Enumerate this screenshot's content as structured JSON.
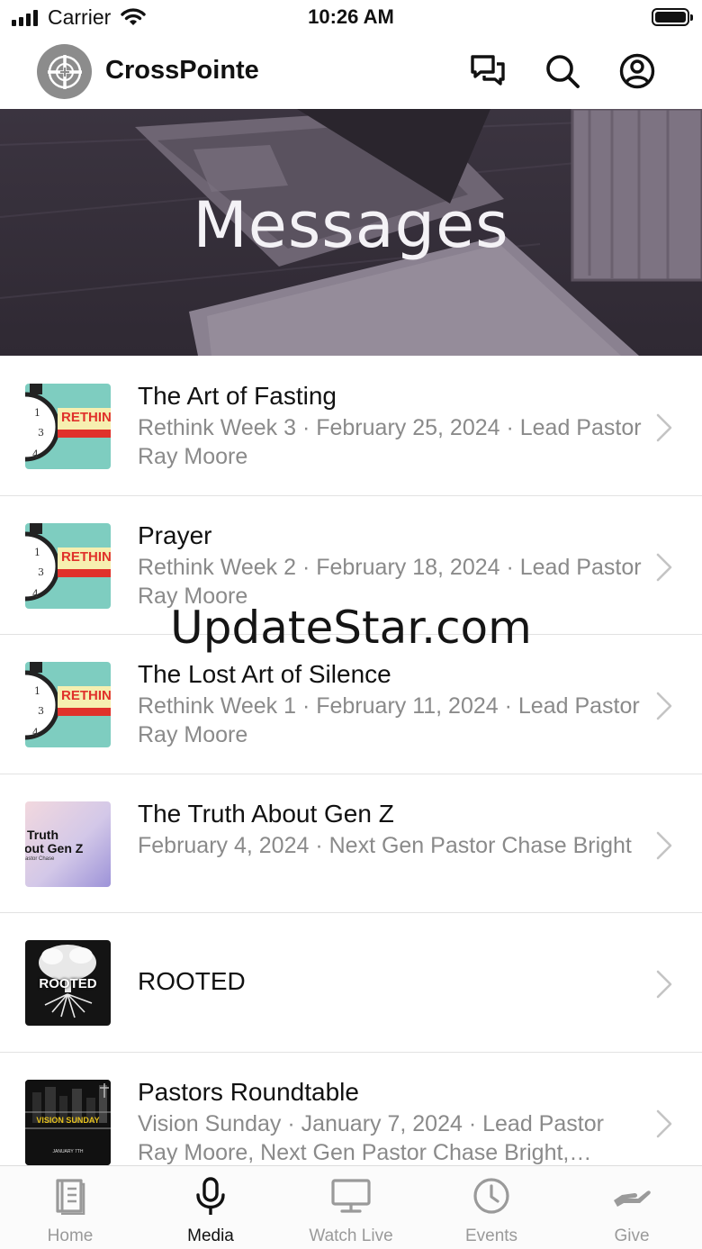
{
  "status_bar": {
    "carrier": "Carrier",
    "time": "10:26 AM"
  },
  "header": {
    "app_name": "CrossPointe",
    "icons": [
      "chat-bubbles-icon",
      "search-icon",
      "profile-icon"
    ]
  },
  "hero": {
    "title": "Messages"
  },
  "messages": [
    {
      "title": "The Art of Fasting",
      "subtitle": "Rethink Week 3 · February 25, 2024 · Lead Pastor Ray Moore",
      "thumb": "rethink",
      "thumb_text": "RETHIN"
    },
    {
      "title": "Prayer",
      "subtitle": "Rethink Week 2 · February 18, 2024 · Lead Pastor Ray Moore",
      "thumb": "rethink",
      "thumb_text": "RETHIN"
    },
    {
      "title": "The Lost Art of Silence",
      "subtitle": "Rethink Week 1 · February 11, 2024 · Lead Pastor Ray Moore",
      "thumb": "rethink",
      "thumb_text": "RETHIN"
    },
    {
      "title": "The Truth About Gen Z",
      "subtitle": "February 4, 2024 · Next Gen Pastor Chase Bright",
      "thumb": "genz",
      "thumb_text_1": "Truth",
      "thumb_text_2": "out Gen Z",
      "thumb_text_3": "astor Chase"
    },
    {
      "title": "ROOTED",
      "subtitle": "",
      "thumb": "rooted",
      "thumb_text": "ROOTED"
    },
    {
      "title": "Pastors Roundtable",
      "subtitle": "Vision Sunday · January 7, 2024 · Lead Pastor Ray Moore, Next Gen Pastor Chase Bright,…",
      "thumb": "vision",
      "thumb_text": "VISION SUNDAY",
      "thumb_text_2": "JANUARY 7TH"
    }
  ],
  "watermark": "UpdateStar.com",
  "tabs": [
    {
      "label": "Home",
      "icon": "book-icon",
      "active": false
    },
    {
      "label": "Media",
      "icon": "microphone-icon",
      "active": true
    },
    {
      "label": "Watch Live",
      "icon": "monitor-icon",
      "active": false
    },
    {
      "label": "Events",
      "icon": "clock-icon",
      "active": false
    },
    {
      "label": "Give",
      "icon": "giving-hand-icon",
      "active": false
    }
  ],
  "colors": {
    "accent": "#111111",
    "muted": "#8a8a8a",
    "inactive_tab": "#9a9a9a",
    "rethink_teal": "#7ecdc0",
    "rethink_banner": "#f6efb0",
    "rethink_red": "#e0312b"
  }
}
